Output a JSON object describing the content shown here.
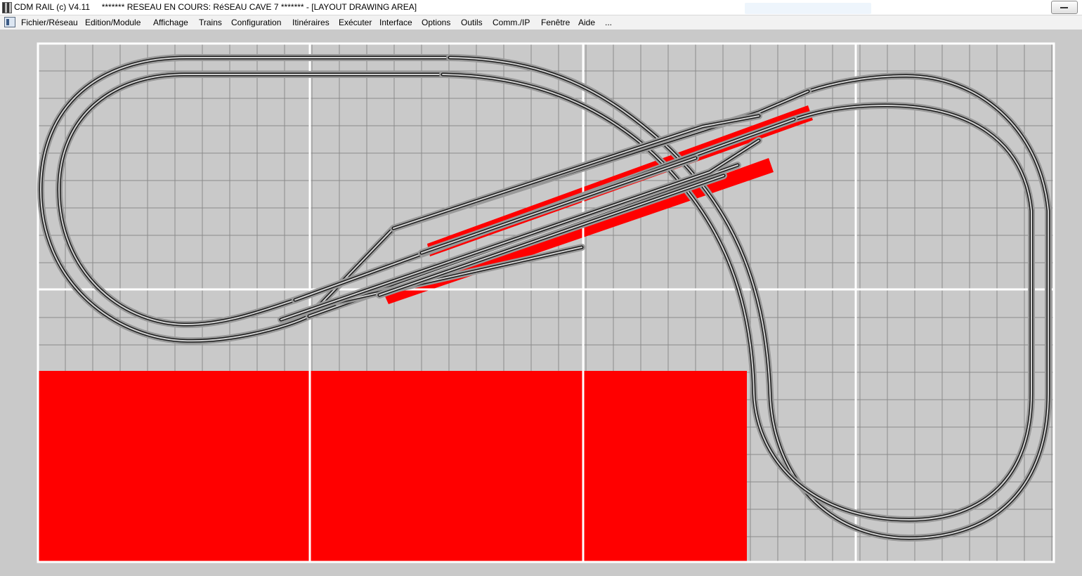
{
  "window": {
    "title": "CDM RAIL (c) V4.11     ******* RESEAU EN COURS: RéSEAU CAVE 7 ******* - [LAYOUT DRAWING AREA]"
  },
  "menu": {
    "items": [
      {
        "id": "fichier",
        "label": "Fichier/Réseau"
      },
      {
        "id": "edition",
        "label": "Edition/Module"
      },
      {
        "id": "affichage",
        "label": "Affichage"
      },
      {
        "id": "trains",
        "label": "Trains"
      },
      {
        "id": "configuration",
        "label": "Configuration"
      },
      {
        "id": "itineraires",
        "label": "Itinéraires"
      },
      {
        "id": "executer",
        "label": "Exécuter"
      },
      {
        "id": "interface",
        "label": "Interface"
      },
      {
        "id": "options",
        "label": "Options"
      },
      {
        "id": "outils",
        "label": "Outils"
      },
      {
        "id": "comm",
        "label": "Comm./IP"
      },
      {
        "id": "fenetre",
        "label": "Fenêtre"
      },
      {
        "id": "aide",
        "label": "Aide"
      },
      {
        "id": "more",
        "label": "..."
      }
    ]
  },
  "colors": {
    "background": "#c9c9c9",
    "grid_line": "#8a8a8a",
    "module_border": "#ffffff",
    "platform": "#ff0000",
    "track_ballast": "#999999",
    "rail": "#1a1a1a"
  },
  "icons": {
    "app": "app-icon",
    "system_menu": "system-menu-icon",
    "restore": "restore-icon"
  }
}
